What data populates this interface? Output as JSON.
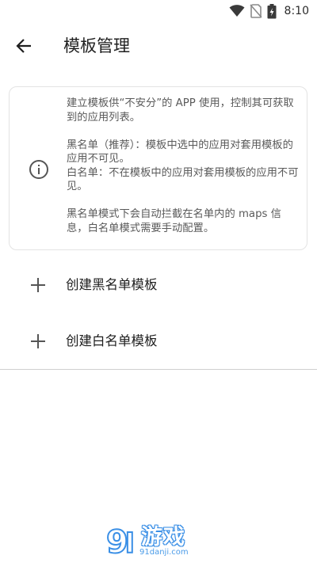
{
  "status_bar": {
    "time": "8:10",
    "icons": [
      "wifi-icon",
      "no-sim-icon",
      "battery-charging-icon"
    ]
  },
  "app_bar": {
    "back_icon": "arrow-back-icon",
    "title": "模板管理"
  },
  "info_card": {
    "icon": "info-icon",
    "paragraphs": [
      "建立模板供“不安分”的 APP 使用，控制其可获取到的应用列表。",
      "黑名单（推荐）：模板中选中的应用对套用模板的应用不可见。",
      "白名单：不在模板中的应用对套用模板的应用不可见。",
      "黑名单模式下会自动拦截在名单内的 maps 信息，白名单模式需要手动配置。"
    ]
  },
  "actions": [
    {
      "icon": "plus-icon",
      "label": "创建黑名单模板"
    },
    {
      "icon": "plus-icon",
      "label": "创建白名单模板"
    }
  ],
  "watermark": {
    "brand": "游戏",
    "url": "91danji.com"
  }
}
